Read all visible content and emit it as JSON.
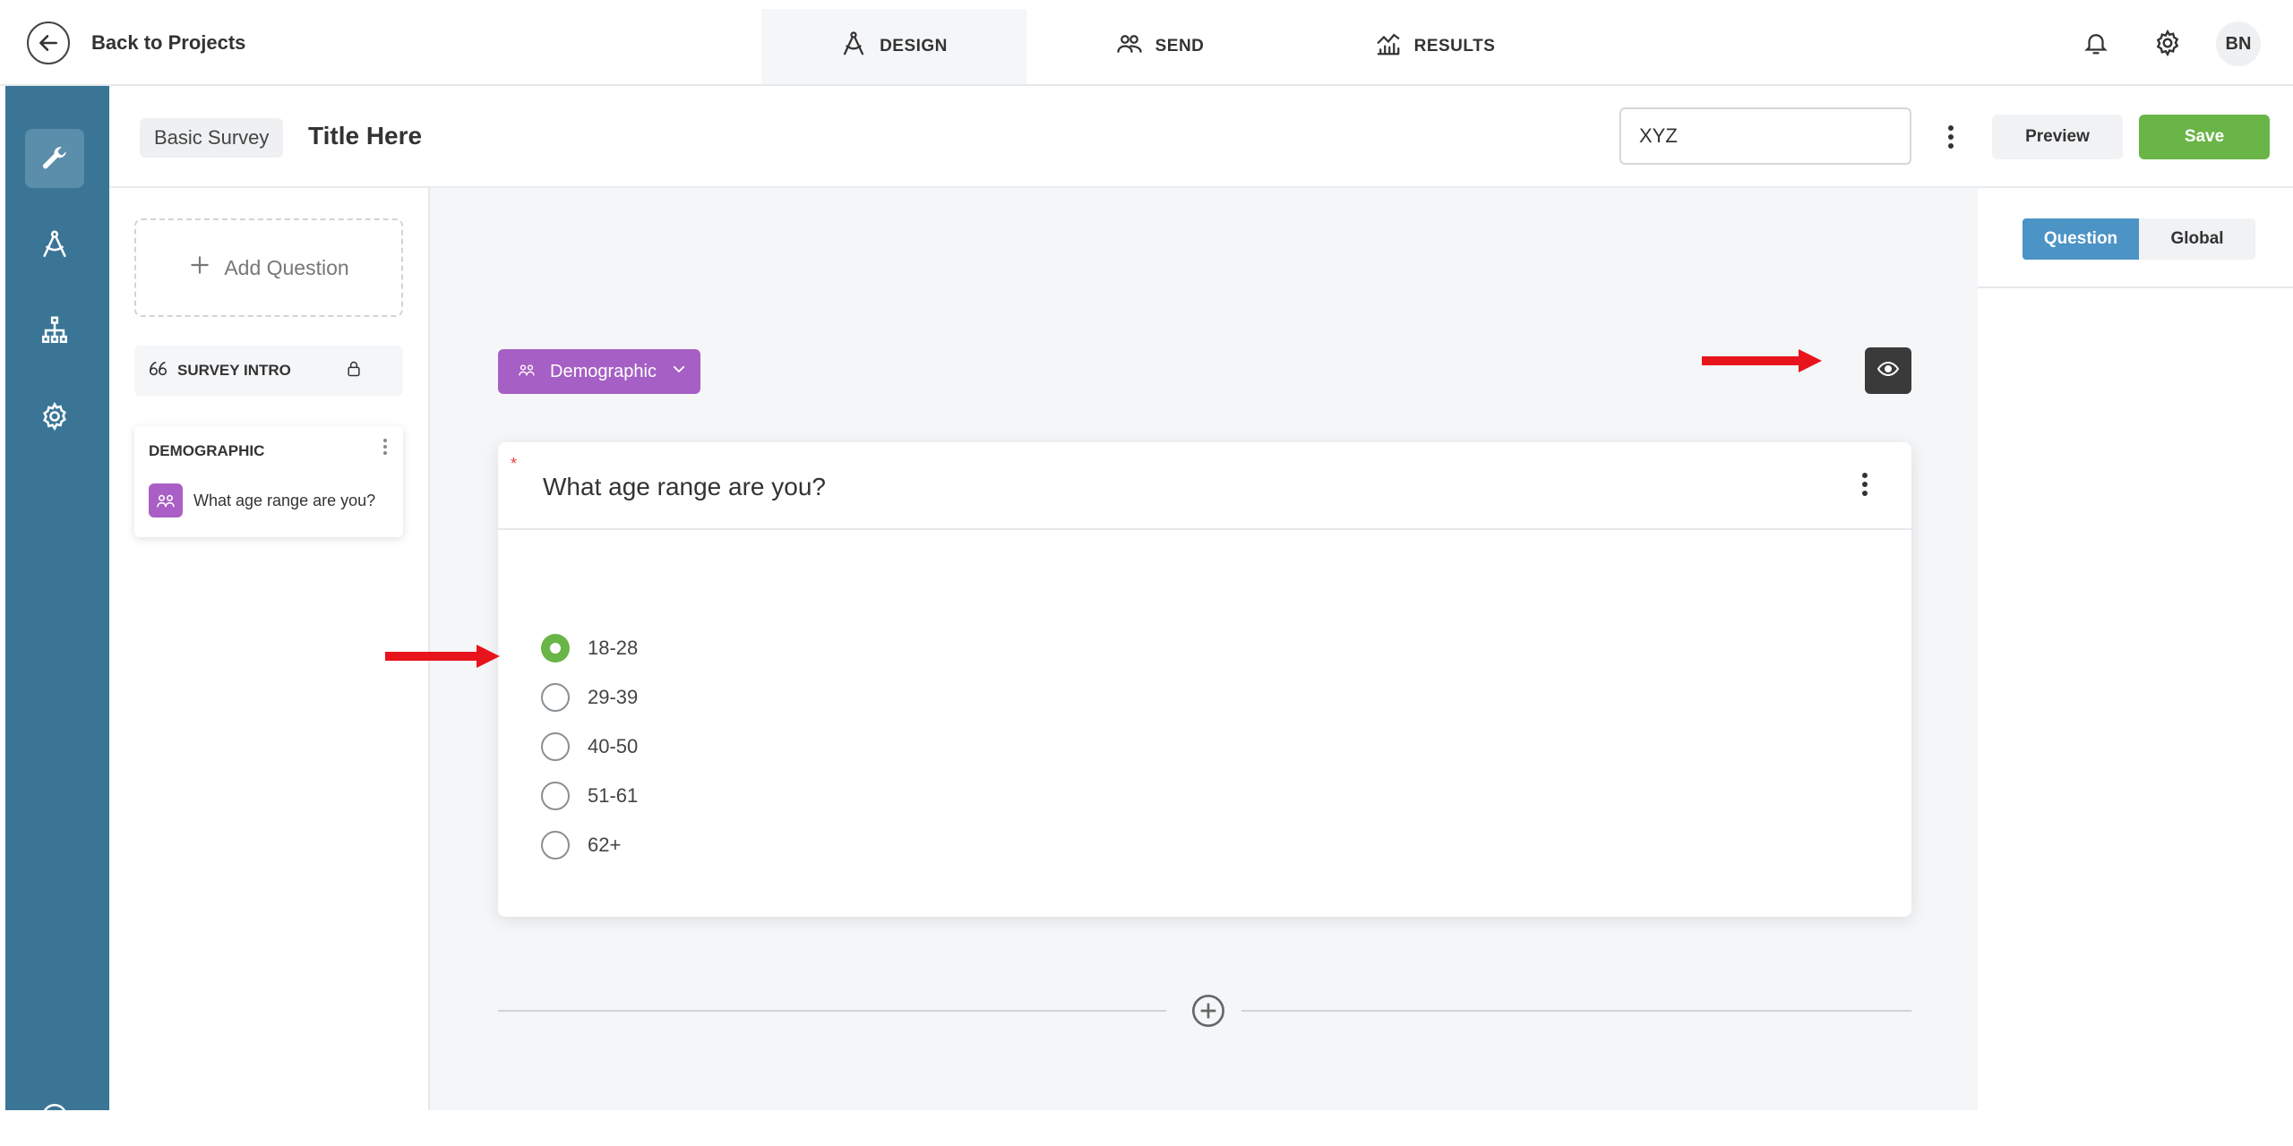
{
  "topbar": {
    "back_label": "Back to Projects",
    "tabs": [
      {
        "label": "DESIGN",
        "icon": "design-icon"
      },
      {
        "label": "SEND",
        "icon": "users-icon"
      },
      {
        "label": "RESULTS",
        "icon": "chart-icon"
      }
    ],
    "avatar_initials": "BN"
  },
  "rail": {
    "items": [
      "wrench-icon",
      "design-icon",
      "hierarchy-icon",
      "gear-icon",
      "plus-circle-icon"
    ]
  },
  "survey_header": {
    "type_label": "Basic Survey",
    "title": "Title Here",
    "name_value": "XYZ",
    "preview_label": "Preview",
    "save_label": "Save"
  },
  "question_list": {
    "add_question_label": "Add Question",
    "intro_label": "SURVEY INTRO",
    "block": {
      "title": "DEMOGRAPHIC",
      "question": "What age range are you?"
    }
  },
  "canvas": {
    "category_label": "Demographic",
    "question": {
      "text": "What age range are you?",
      "options": [
        "18-28",
        "29-39",
        "40-50",
        "51-61",
        "62+"
      ],
      "selected": "18-28"
    }
  },
  "right_panel": {
    "tabs": [
      "Question",
      "Global"
    ],
    "active_tab": "Question"
  },
  "colors": {
    "rail": "#3a7596",
    "save_green": "#6ab547",
    "category_purple": "#a65fc4",
    "tab_blue": "#4c93c6",
    "annotation_red": "#e8141c"
  }
}
